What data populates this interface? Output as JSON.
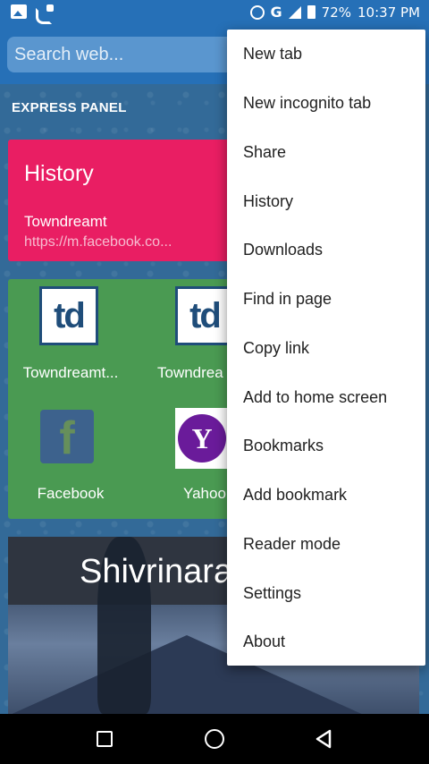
{
  "status_bar": {
    "battery": "72%",
    "time": "10:37 PM",
    "network": "G"
  },
  "toolbar": {
    "search_placeholder": "Search web..."
  },
  "express_panel": {
    "label": "EXPRESS PANEL"
  },
  "history_card": {
    "title": "History",
    "site": "Towndreamt",
    "url": "https://m.facebook.co..."
  },
  "speed_dial": [
    {
      "label": "Towndreamt...",
      "logo": "td"
    },
    {
      "label": "Towndrea",
      "logo": "td"
    },
    {
      "label": "Facebook",
      "logo": "f"
    },
    {
      "label": "Yahoo",
      "logo": "Y"
    }
  ],
  "photo_card": {
    "title": "Shivrinara"
  },
  "menu": {
    "items": [
      "New tab",
      "New incognito tab",
      "Share",
      "History",
      "Downloads",
      "Find in page",
      "Copy link",
      "Add to home screen",
      "Bookmarks",
      "Add bookmark",
      "Reader mode",
      "Settings",
      "About"
    ]
  }
}
